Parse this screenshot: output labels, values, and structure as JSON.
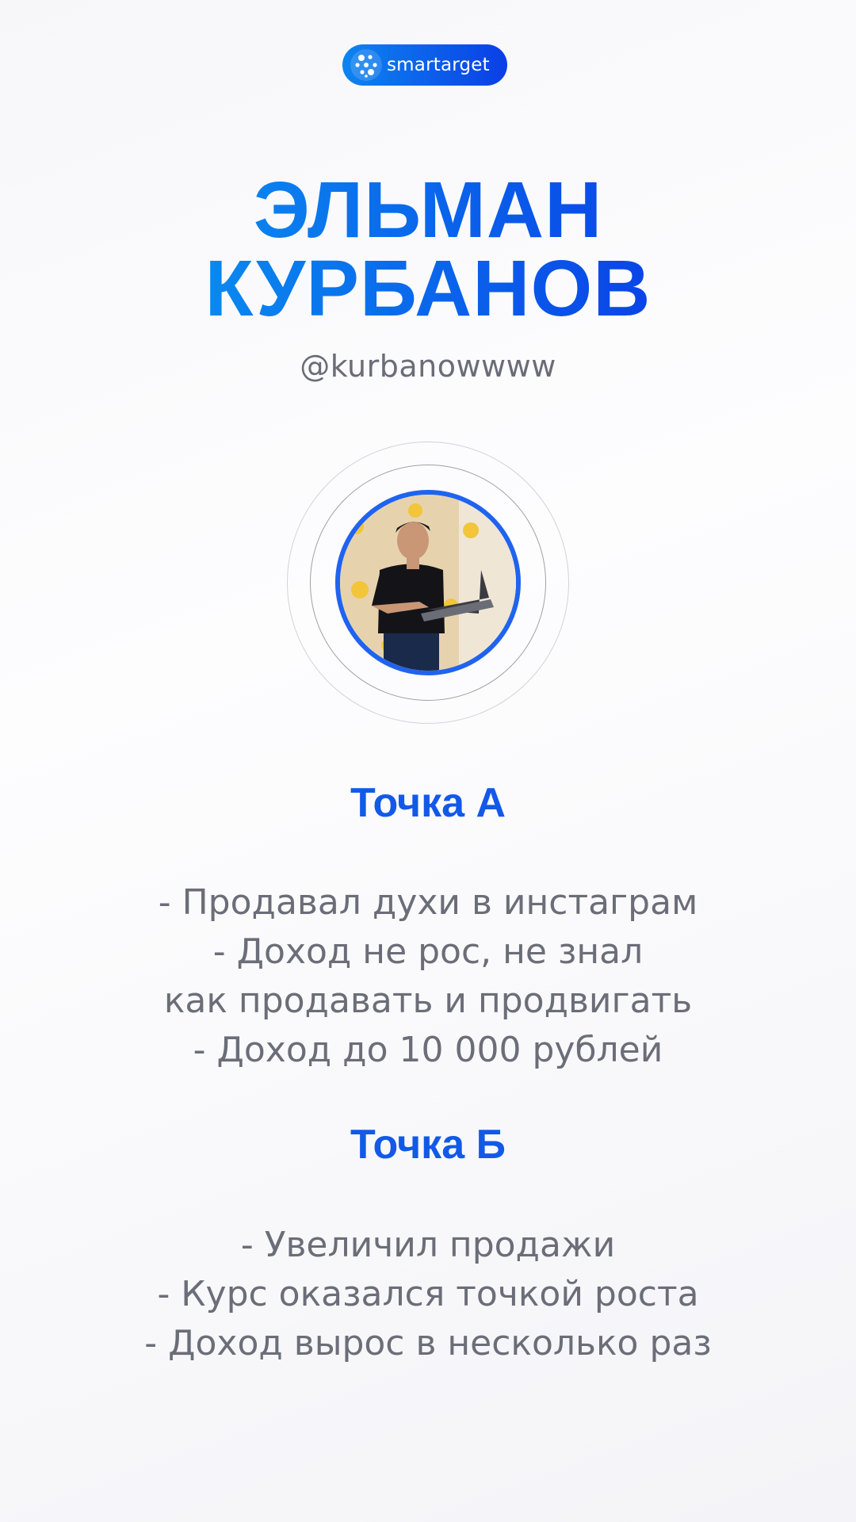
{
  "logo": {
    "text": "smartarget",
    "icon": "molecule-logo-icon"
  },
  "name": {
    "line1": "ЭЛЬМАН",
    "line2": "КУРБАНОВ"
  },
  "handle": "@kurbanowwww",
  "avatar": {
    "icon": "person-photo-icon"
  },
  "point_a": {
    "title": "Точка А",
    "lines": [
      "- Продавал духи в инстаграм",
      "- Доход не рос, не знал",
      "как продавать и продвигать",
      "- Доход до 10 000 рублей"
    ]
  },
  "point_b": {
    "title": "Точка Б",
    "lines": [
      "- Увеличил продажи",
      "- Курс оказался точкой роста",
      "- Доход вырос в несколько раз"
    ]
  },
  "colors": {
    "accent_start": "#0a8ef0",
    "accent_end": "#0a3fe6",
    "section_title": "#1359e8",
    "body_text": "#6b6e78"
  }
}
